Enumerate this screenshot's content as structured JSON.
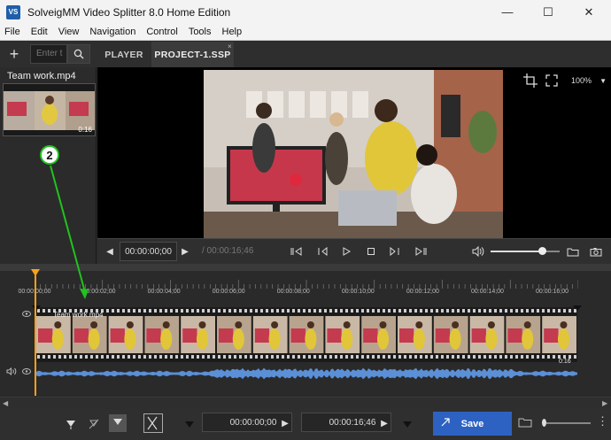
{
  "window": {
    "title": "SolveigMM Video Splitter 8.0 Home Edition",
    "logo_text": "VS"
  },
  "window_controls": {
    "minimize": "—",
    "maximize": "☐",
    "close": "✕"
  },
  "menu": [
    "File",
    "Edit",
    "View",
    "Navigation",
    "Control",
    "Tools",
    "Help"
  ],
  "toolbar": {
    "add_label": "+",
    "search_placeholder": "Enter t"
  },
  "tabs": {
    "player": "PLAYER",
    "project": "PROJECT-1.SSP",
    "close": "×"
  },
  "media": {
    "filename": "Team work.mp4",
    "duration": "0:16"
  },
  "player": {
    "zoom": "100%"
  },
  "transport": {
    "current_time": "00:00:00;00",
    "total_time": "/ 00:00:16;46",
    "volume": 0.74
  },
  "timeline": {
    "ticks": [
      "00:00:00;00",
      "00:00:02;00",
      "00:00:04;00",
      "00:00:06;00",
      "00:00:08;00",
      "00:00:10;00",
      "00:00:12;00",
      "00:00:14;00",
      "00:00:16;00"
    ],
    "track_label": "Team work.mp4",
    "track_duration": "0:16"
  },
  "annotation": {
    "number": "2"
  },
  "bottom": {
    "start_time": "00:00:00;00",
    "end_time": "00:00:16;46",
    "save_label": "Save"
  },
  "colors": {
    "accent": "#2e62c2",
    "playhead": "#f7a21b",
    "waveform": "#5b8fd6",
    "callout": "#22c21f"
  }
}
